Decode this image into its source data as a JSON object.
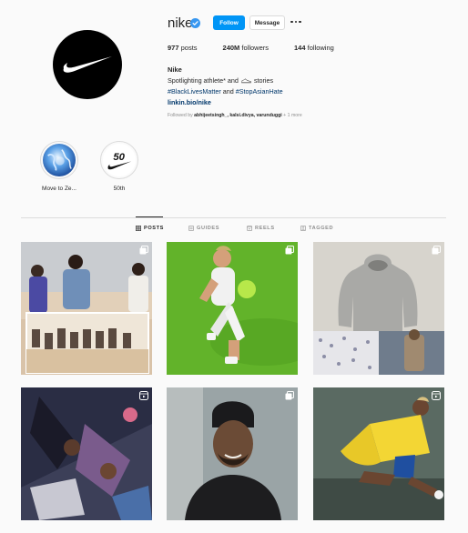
{
  "profile": {
    "username": "nike",
    "follow_label": "Follow",
    "message_label": "Message",
    "posts_count": "977",
    "posts_label": "posts",
    "followers_count": "240M",
    "followers_label": "followers",
    "following_count": "144",
    "following_label": "following",
    "display_name": "Nike",
    "bio_line1_before": "Spotlighting athlete* and",
    "bio_line1_after": "stories",
    "bio_tag1": "#BlackLivesMatter",
    "bio_and": "and",
    "bio_tag2": "#StopAsianHate",
    "link": "linkin.bio/nike",
    "followed_by_prefix": "Followed by",
    "followed_by_names": "abhijeetsingh_, kalsi.divya, varunduggi",
    "followed_by_more": "+ 1 more"
  },
  "highlights": [
    {
      "label": "Move to Ze..."
    },
    {
      "label": "50th",
      "badge": "50"
    }
  ],
  "tabs": [
    {
      "label": "POSTS",
      "icon": "grid-icon",
      "active": true
    },
    {
      "label": "GUIDES",
      "icon": "guides-icon",
      "active": false
    },
    {
      "label": "REELS",
      "icon": "reels-icon",
      "active": false
    },
    {
      "label": "TAGGED",
      "icon": "tagged-icon",
      "active": false
    }
  ],
  "posts": [
    {
      "icon": "multiple-posts-icon"
    },
    {
      "icon": "multiple-posts-icon"
    },
    {
      "icon": "multiple-posts-icon"
    },
    {
      "icon": "reel-icon"
    },
    {
      "icon": "multiple-posts-icon"
    },
    {
      "icon": "reel-icon"
    }
  ],
  "colors": {
    "follow_button": "#0095f6",
    "link": "#00376b",
    "verified": "#3897f0"
  }
}
